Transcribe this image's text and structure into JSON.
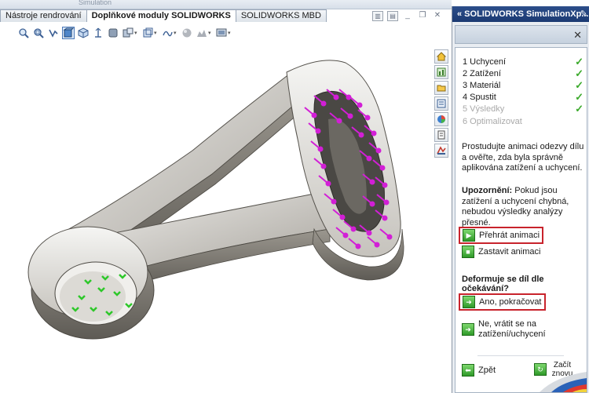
{
  "top_strip": {
    "text": "Simulation"
  },
  "tabs": [
    {
      "label": "Nástroje rendrování",
      "active": false
    },
    {
      "label": "Doplňkové moduly SOLIDWORKS",
      "active": true
    },
    {
      "label": "SOLIDWORKS MBD",
      "active": false
    }
  ],
  "view_toolbar": {
    "icons": [
      "zoom-to-fit-icon",
      "zoom-to-area-icon",
      "previous-view-icon",
      "section-view-icon",
      "view-orientation-icon",
      "display-style-icon",
      "hide-show-items-icon",
      "edit-appearance-icon",
      "apply-scene-icon",
      "view-settings-icon",
      "display-manager-icon"
    ]
  },
  "task_pane": {
    "title": "« SOLIDWORKS SimulationXp...",
    "steps": [
      {
        "label": "1  Uchycení",
        "done": true,
        "enabled": true
      },
      {
        "label": "2  Zatížení",
        "done": true,
        "enabled": true
      },
      {
        "label": "3  Materiál",
        "done": true,
        "enabled": true
      },
      {
        "label": "4  Spustit",
        "done": true,
        "enabled": true
      },
      {
        "label": "5  Výsledky",
        "done": false,
        "enabled": false
      },
      {
        "label": "6  Optimalizovat",
        "done": false,
        "enabled": false
      }
    ],
    "instruction": "Prostudujte animaci odezvy dílu a ověřte, zda byla správně aplikována zatížení a uchycení.",
    "warning_label": "Upozornění:",
    "warning_text": " Pokud jsou zatížení a uchycení chybná, nebudou výsledky analýzy přesné.",
    "play_animation": "Přehrát animaci",
    "stop_animation": "Zastavit animaci",
    "question": "Deformuje se díl dle očekávání?",
    "yes_continue": "Ano, pokračovat",
    "no_return": "Ne, vrátit se na zatížení/uchycení",
    "back": "Zpět",
    "restart": "Začít znovu"
  },
  "colors": {
    "pane_header": "#1b3a72",
    "highlight_box": "#c8232c",
    "check_green": "#3caa2c",
    "force_arrows": "#d21fd6",
    "fixture_arrows": "#2ec82a",
    "part_body": "#8e8a83"
  }
}
